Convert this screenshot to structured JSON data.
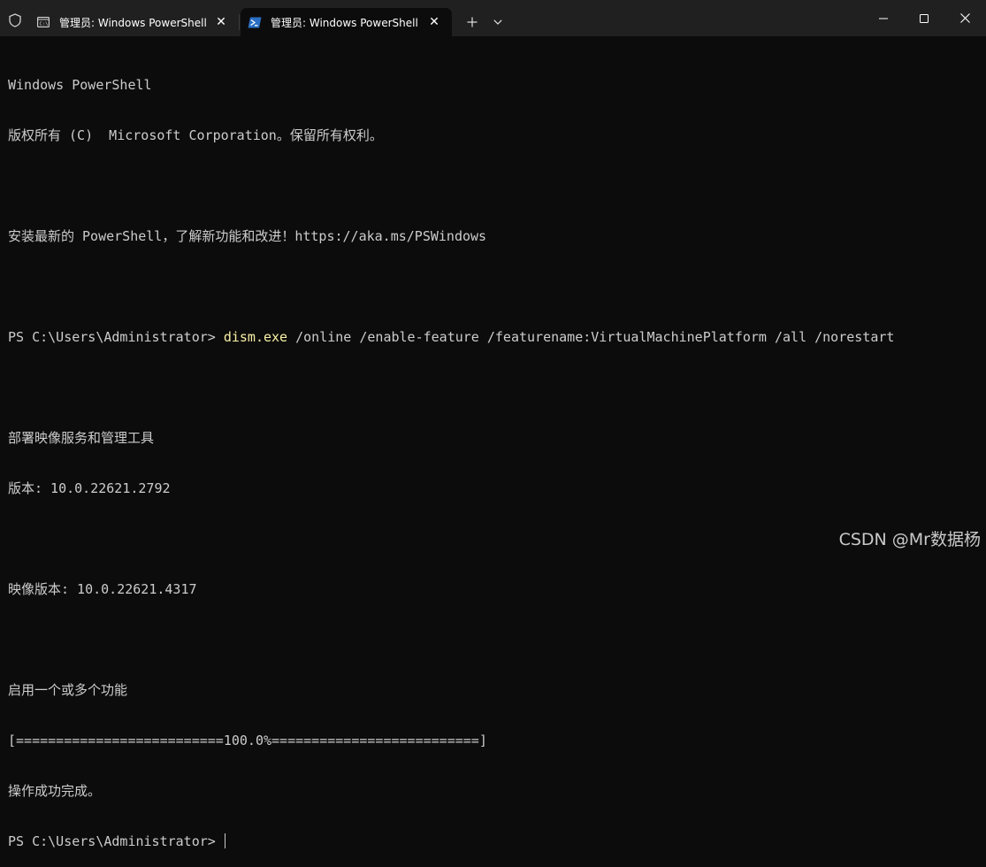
{
  "window": {
    "tabs": [
      {
        "title": "管理员: Windows PowerShell",
        "close": "✕"
      },
      {
        "title": "管理员: Windows PowerShell",
        "close": "✕"
      }
    ],
    "new_tab": "+",
    "colors": {
      "titlebar": "#202020",
      "background": "#0c0c0c",
      "text": "#cccccc",
      "command": "#f9f1a5"
    },
    "icons": [
      "shield-icon",
      "cmd-icon",
      "powershell-icon",
      "plus-icon",
      "chevron-down-icon",
      "minimize-icon",
      "maximize-icon",
      "close-icon"
    ]
  },
  "terminal": {
    "banner1": "Windows PowerShell",
    "banner2": "版权所有 (C)  Microsoft Corporation。保留所有权利。",
    "banner3": "安装最新的 PowerShell，了解新功能和改进！https://aka.ms/PSWindows",
    "prompt": "PS C:\\Users\\Administrator> ",
    "cmd_name": "dism.exe",
    "cmd_args": " /online /enable-feature /featurename:VirtualMachinePlatform /all /norestart",
    "out_title": "部署映像服务和管理工具",
    "out_version": "版本: 10.0.22621.2792",
    "out_image_version": "映像版本: 10.0.22621.4317",
    "out_enabling": "启用一个或多个功能",
    "out_progress": "[==========================100.0%==========================]",
    "out_done": "操作成功完成。",
    "prompt2": "PS C:\\Users\\Administrator> "
  },
  "watermark": "CSDN @Mr数据杨"
}
